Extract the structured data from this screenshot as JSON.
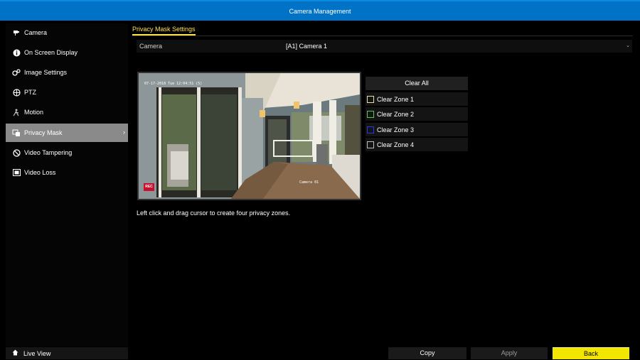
{
  "window": {
    "title": "Camera Management"
  },
  "sidebar": {
    "items": [
      {
        "label": "Camera",
        "icon": "camera-icon"
      },
      {
        "label": "On Screen Display",
        "icon": "info-icon"
      },
      {
        "label": "Image Settings",
        "icon": "image-settings-icon"
      },
      {
        "label": "PTZ",
        "icon": "ptz-icon"
      },
      {
        "label": "Motion",
        "icon": "motion-icon"
      },
      {
        "label": "Privacy Mask",
        "icon": "privacy-mask-icon",
        "active": true
      },
      {
        "label": "Video Tampering",
        "icon": "tampering-icon"
      },
      {
        "label": "Video Loss",
        "icon": "video-loss-icon"
      }
    ],
    "live_view": {
      "label": "Live View",
      "icon": "home-icon"
    }
  },
  "main": {
    "tab": "Privacy Mask Settings",
    "camera_row": {
      "label": "Camera",
      "value": "[A1] Camera 1"
    },
    "preview": {
      "osd_time": "07-17-2018 Tue 12:04:51 (5)",
      "osd_camera": "Camera 01",
      "rec_badge": "REC"
    },
    "clear_all": "Clear All",
    "zones": [
      {
        "label": "Clear Zone 1",
        "color": "#e8e0a0"
      },
      {
        "label": "Clear Zone 2",
        "color": "#5cc45c"
      },
      {
        "label": "Clear Zone 3",
        "color": "#2a3ad8"
      },
      {
        "label": "Clear Zone 4",
        "color": "#bdbdbd"
      }
    ],
    "hint": "Left click and drag cursor to create four privacy zones."
  },
  "buttons": {
    "copy": "Copy",
    "apply": "Apply",
    "back": "Back"
  },
  "colors": {
    "titlebar": "#0073c6",
    "accent": "#ffe14a",
    "back_button": "#f2e600",
    "active_item": "#8a8a8a"
  }
}
